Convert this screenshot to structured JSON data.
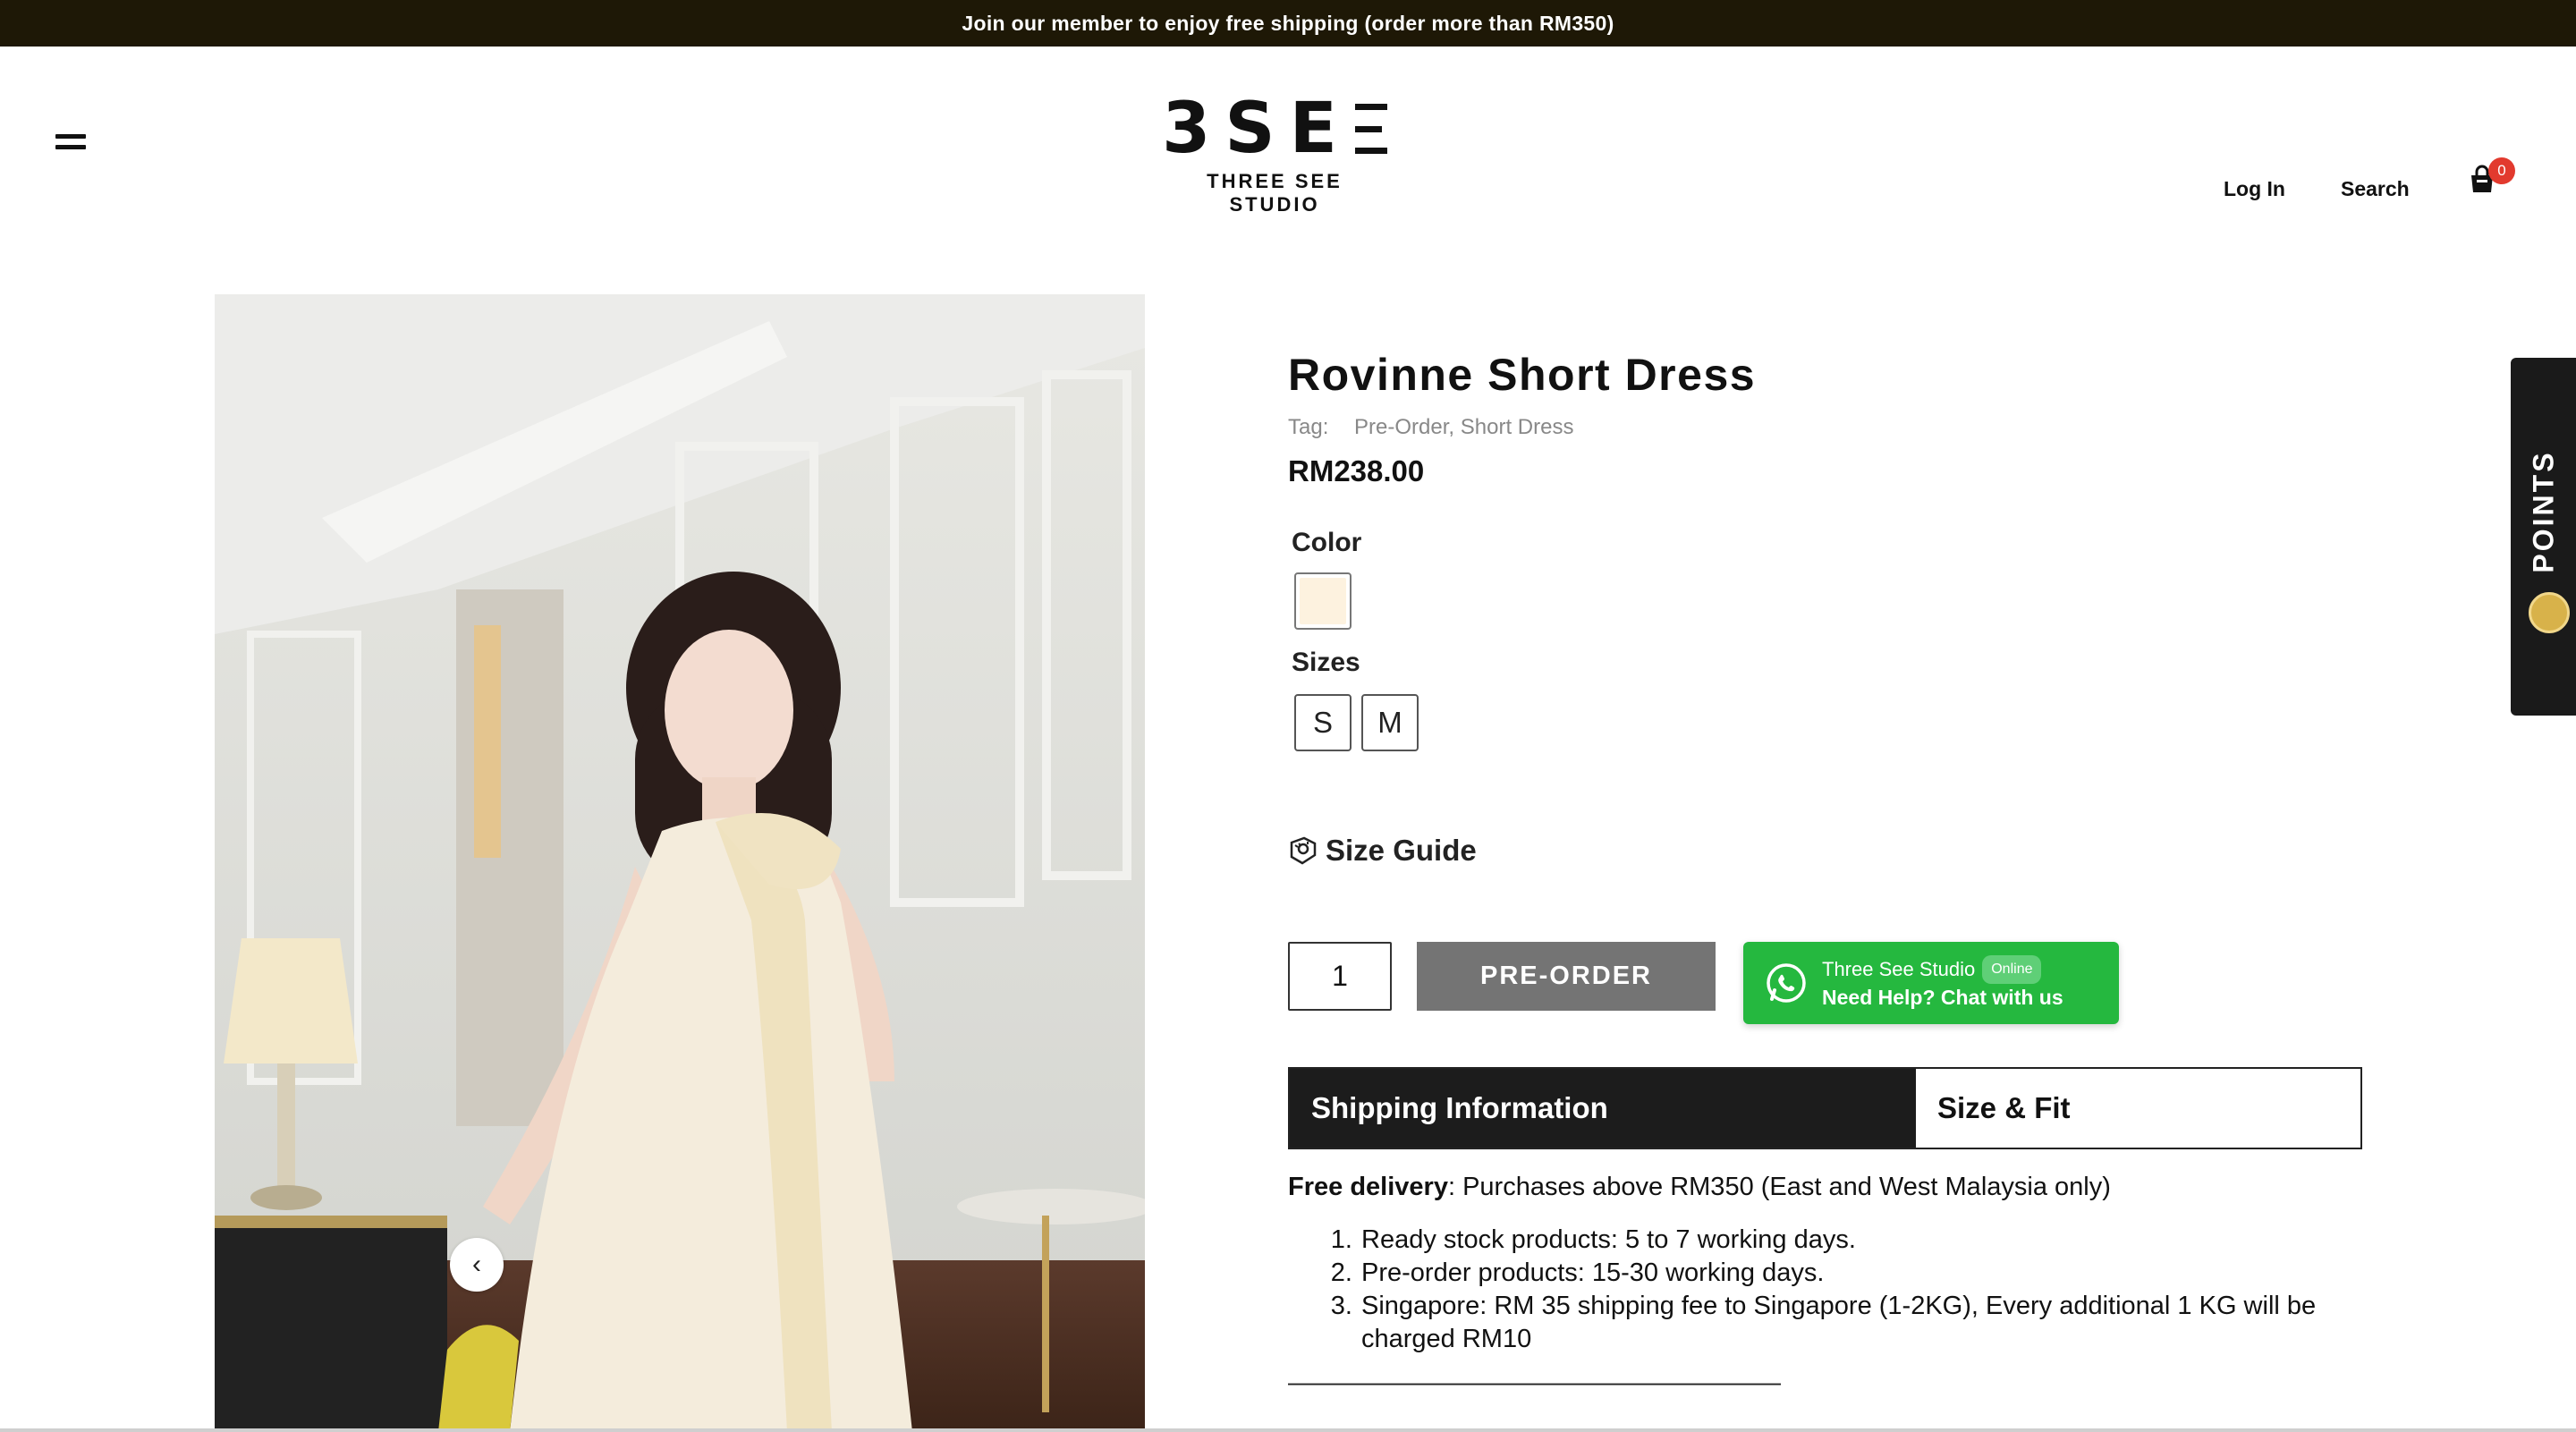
{
  "announcement": "Join our member to enjoy free shipping (order more than RM350)",
  "brand": {
    "mark": "3SE",
    "name": "THREE SEE STUDIO"
  },
  "nav": {
    "login": "Log In",
    "search": "Search",
    "cart_count": "0"
  },
  "gallery": {
    "prev_icon": "‹",
    "next_icon": "›"
  },
  "product": {
    "title": "Rovinne Short Dress",
    "tag_label": "Tag:",
    "tags": "Pre-Order, Short Dress",
    "price": "RM238.00",
    "color_label": "Color",
    "color_swatch": "#fdf2df",
    "sizes_label": "Sizes",
    "sizes": [
      "S",
      "M"
    ],
    "size_guide": "Size Guide",
    "quantity": "1",
    "preorder_button": "PRE-ORDER"
  },
  "whatsapp": {
    "name": "Three See Studio",
    "status": "Online",
    "cta": "Need Help? Chat with us"
  },
  "tabs": {
    "shipping": "Shipping Information",
    "size_fit": "Size & Fit"
  },
  "shipping": {
    "free_label": "Free delivery",
    "free_text": ": Purchases above RM350 (East and West Malaysia only)",
    "items": [
      "Ready stock products: 5 to 7 working days.",
      "Pre-order products: 15-30 working days.",
      "Singapore: RM 35 shipping fee to Singapore (1-2KG), Every additional 1 KG will be charged RM10"
    ],
    "divider": "———————————————————"
  },
  "points_tab": "POINTS",
  "colors": {
    "topbar": "#1e1806",
    "accent_whatsapp": "#25b83f",
    "preorder_button": "#747474",
    "cart_badge": "#e23a2e"
  }
}
